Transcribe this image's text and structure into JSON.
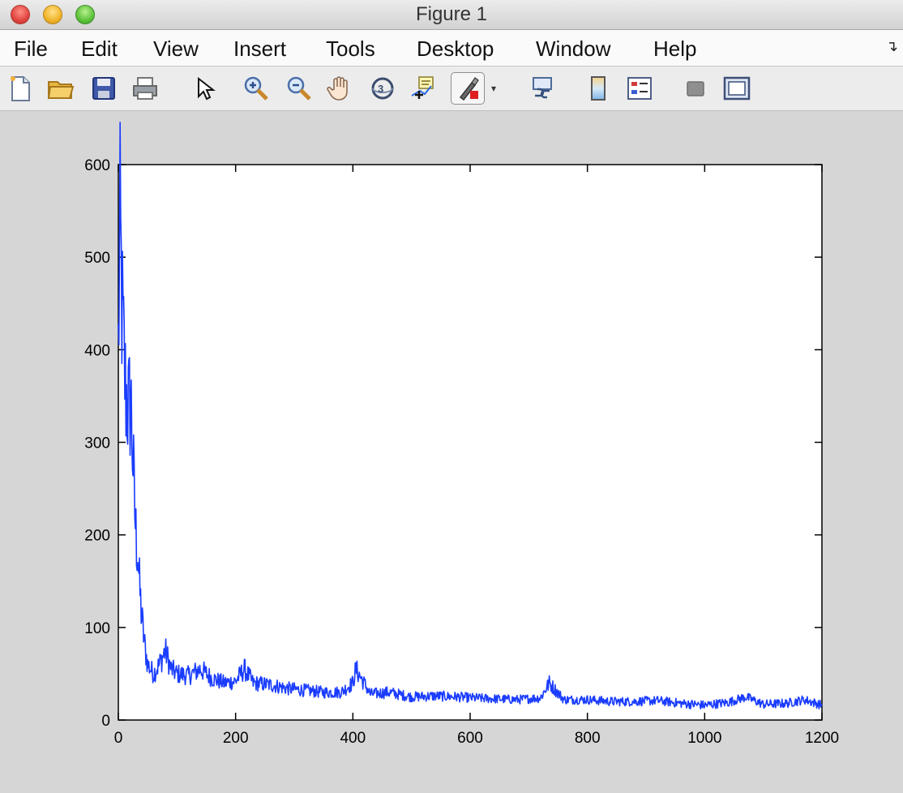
{
  "window": {
    "title": "Figure 1"
  },
  "menu": [
    "File",
    "Edit",
    "View",
    "Insert",
    "Tools",
    "Desktop",
    "Window",
    "Help"
  ],
  "toolbar": {
    "icons": [
      "new-file-icon",
      "open-folder-icon",
      "save-icon",
      "print-icon",
      "pointer-icon",
      "zoom-in-icon",
      "zoom-out-icon",
      "pan-hand-icon",
      "rotate-3d-icon",
      "data-cursor-icon",
      "brush-icon",
      "link-plot-icon",
      "colorbar-icon",
      "legend-icon",
      "hide-plot-tools-icon",
      "show-plot-tools-icon"
    ]
  },
  "colors": {
    "line": "#1a3cff",
    "axes_bg": "#ffffff",
    "figure_bg": "#d6d6d6"
  },
  "chart_data": {
    "type": "line",
    "xlim": [
      0,
      1200
    ],
    "ylim": [
      0,
      600
    ],
    "xticks": [
      0,
      200,
      400,
      600,
      800,
      1000,
      1200
    ],
    "yticks": [
      0,
      100,
      200,
      300,
      400,
      500,
      600
    ],
    "grid": false,
    "series": [
      {
        "color": "#1a3cff",
        "x": [
          0,
          3,
          6,
          9,
          12,
          15,
          18,
          21,
          24,
          27,
          30,
          33,
          36,
          40,
          45,
          50,
          55,
          60,
          70,
          80,
          90,
          100,
          120,
          140,
          160,
          180,
          200,
          215,
          230,
          260,
          290,
          320,
          350,
          380,
          400,
          405,
          430,
          460,
          500,
          540,
          580,
          600,
          640,
          680,
          720,
          735,
          760,
          800,
          840,
          880,
          920,
          960,
          1000,
          1040,
          1070,
          1100,
          1140,
          1170,
          1200
        ],
        "y": [
          400,
          530,
          450,
          400,
          360,
          345,
          335,
          350,
          300,
          240,
          200,
          185,
          145,
          110,
          80,
          60,
          55,
          50,
          60,
          75,
          55,
          50,
          48,
          55,
          45,
          40,
          42,
          55,
          40,
          38,
          34,
          32,
          30,
          30,
          40,
          55,
          28,
          30,
          25,
          26,
          25,
          24,
          23,
          22,
          24,
          40,
          22,
          22,
          20,
          20,
          21,
          18,
          16,
          19,
          25,
          17,
          18,
          22,
          16
        ]
      }
    ]
  }
}
